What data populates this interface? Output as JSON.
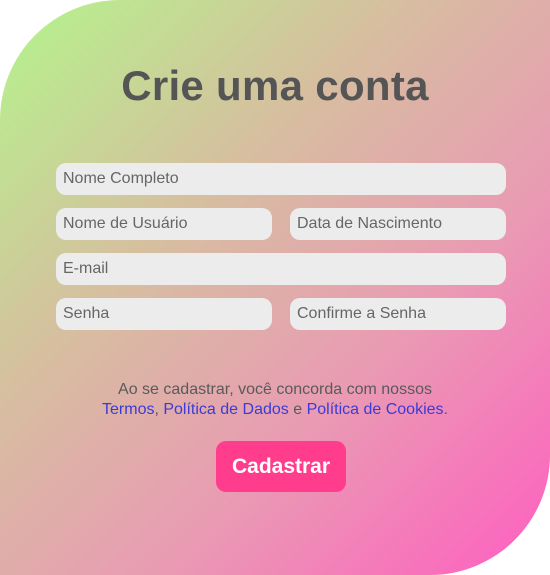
{
  "form": {
    "title": "Crie uma conta",
    "fields": {
      "full_name": {
        "placeholder": "Nome Completo",
        "value": ""
      },
      "username": {
        "placeholder": "Nome de Usuário",
        "value": ""
      },
      "birth_date": {
        "placeholder": "Data de Nascimento",
        "value": ""
      },
      "email": {
        "placeholder": "E-mail",
        "value": ""
      },
      "password": {
        "placeholder": "Senha",
        "value": ""
      },
      "confirm_password": {
        "placeholder": "Confirme a Senha",
        "value": ""
      }
    },
    "terms": {
      "intro": "Ao se cadastrar, você concorda com nossos",
      "link_terms": "Termos",
      "sep1": ", ",
      "link_data_policy": "Política de Dados",
      "sep2": " e ",
      "link_cookie_policy": "Política de Cookies",
      "end": "."
    },
    "submit_label": "Cadastrar"
  },
  "colors": {
    "gradient_start": "#b3f58b",
    "gradient_end": "#ff5ec0",
    "title": "#555555",
    "input_bg": "#ececec",
    "link": "#3b3bd6",
    "button_bg": "#ff3d8c",
    "button_text": "#ffffff"
  }
}
